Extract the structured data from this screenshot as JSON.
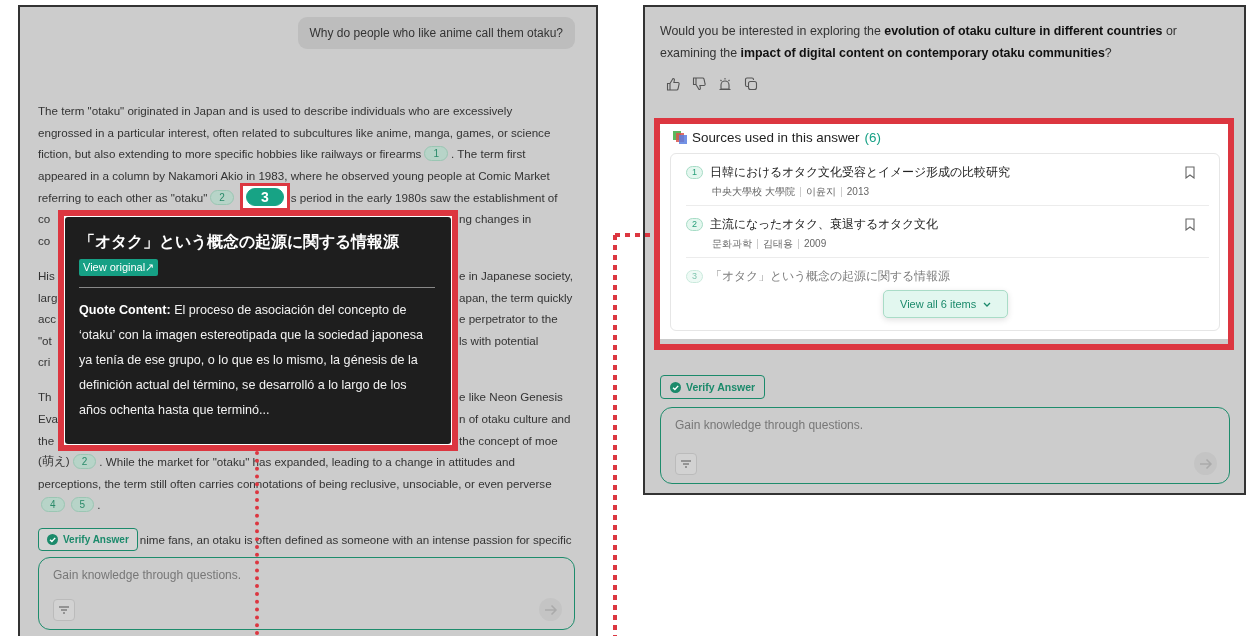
{
  "left_panel": {
    "user_message": "Why do people who like anime call them otaku?",
    "paragraphs": [
      {
        "lines": [
          {
            "left": [
              {
                "kind": "text",
                "text": "The term \"otaku\" originated in Japan and is used to describe individuals who are excessively"
              }
            ]
          },
          {
            "left": [
              {
                "kind": "text",
                "text": "engrossed in a particular interest, often related to subcultures like anime, manga, games, or science"
              }
            ]
          },
          {
            "left": [
              {
                "kind": "text",
                "text": "fiction, but also extending to more specific hobbies like railways or firearms"
              },
              {
                "kind": "cite",
                "number": "1",
                "selected": false
              },
              {
                "kind": "text",
                "text": ". The term first"
              }
            ]
          },
          {
            "left": [
              {
                "kind": "text",
                "text": "appeared in a column by Nakamori Akio in 1983, where he observed young people at Comic Market"
              }
            ]
          },
          {
            "left": [
              {
                "kind": "text",
                "text": "referring to each other as \"otaku\""
              },
              {
                "kind": "cite",
                "number": "2",
                "selected": false
              },
              {
                "kind": "cite",
                "number": "3",
                "selected": true
              },
              {
                "kind": "text",
                "text": "s period in the early 1980s saw the establishment of"
              }
            ]
          },
          {
            "left": [
              {
                "kind": "text",
                "text": "co"
              }
            ],
            "right": [
              {
                "kind": "text",
                "text": "ng changes in"
              }
            ]
          },
          {
            "left": [
              {
                "kind": "text",
                "text": "co"
              }
            ]
          }
        ]
      },
      {
        "lines": [
          {
            "left": [
              {
                "kind": "text",
                "text": "His"
              }
            ],
            "right": [
              {
                "kind": "text",
                "text": "e in Japanese society,"
              }
            ]
          },
          {
            "left": [
              {
                "kind": "text",
                "text": "larg"
              }
            ],
            "right": [
              {
                "kind": "text",
                "text": "apan, the term quickly"
              }
            ]
          },
          {
            "left": [
              {
                "kind": "text",
                "text": "acc"
              }
            ],
            "right": [
              {
                "kind": "text",
                "text": "e perpetrator to the"
              }
            ]
          },
          {
            "left": [
              {
                "kind": "text",
                "text": "\"ot"
              }
            ],
            "right": [
              {
                "kind": "text",
                "text": "ls with potential"
              }
            ]
          },
          {
            "left": [
              {
                "kind": "text",
                "text": "cri"
              }
            ]
          }
        ]
      },
      {
        "lines": [
          {
            "left": [
              {
                "kind": "text",
                "text": "Th"
              }
            ],
            "right": [
              {
                "kind": "text",
                "text": "e like Neon Genesis"
              }
            ]
          },
          {
            "left": [
              {
                "kind": "text",
                "text": "Eva"
              }
            ],
            "right": [
              {
                "kind": "text",
                "text": "n of otaku culture and"
              }
            ]
          },
          {
            "left": [
              {
                "kind": "text",
                "text": "the"
              }
            ],
            "right": [
              {
                "kind": "text",
                "text": "the concept of moe"
              }
            ]
          },
          {
            "left": [
              {
                "kind": "text",
                "text": "(萌え)"
              },
              {
                "kind": "cite",
                "number": "2",
                "selected": false
              },
              {
                "kind": "text",
                "text": ". While the market for \"otaku\" has expanded, leading to a change in attitudes and"
              }
            ]
          },
          {
            "left": [
              {
                "kind": "text",
                "text": "perceptions, the term still often carries connotations of being reclusive, unsociable, or even perverse"
              }
            ]
          },
          {
            "left": [
              {
                "kind": "cite",
                "number": "4",
                "selected": false
              },
              {
                "kind": "cite",
                "number": "5",
                "selected": false
              },
              {
                "kind": "text",
                "text": "."
              }
            ]
          }
        ]
      },
      {
        "lines": [
          {
            "left": [
              {
                "kind": "text",
                "text": "nime fans, an otaku is often defined as someone with an intense passion for specific"
              }
            ]
          }
        ]
      }
    ],
    "verify_button": "Verify Answer",
    "input": {
      "placeholder": "Gain knowledge through questions."
    }
  },
  "tooltip": {
    "title": "「オタク」という概念の起源に関する情報源",
    "link": "View original↗",
    "quote": "**Quote Content:** El proceso de asociación del concepto de ‘otaku’ con la imagen estereotipada que la sociedad japonesa ya tenía de ese grupo, o lo que es lo mismo, la génesis de la definición actual del término, se desarrolló a lo largo de los años ochenta hasta que terminó..."
  },
  "right_panel": {
    "question": "Would you be interested in exploring the **evolution of otaku culture in different countries** or examining the **impact of digital content on contemporary otaku communities**?",
    "sources": {
      "title": "Sources used in this answer",
      "count": "(6)",
      "items": [
        {
          "number": "1",
          "title": "日韓におけるオタク文化受容とイメージ形成の比較研究",
          "meta": [
            "中央大學校 大學院",
            "이윤지",
            "2013"
          ],
          "faded": false
        },
        {
          "number": "2",
          "title": "主流になったオタク、衰退するオタク文化",
          "meta": [
            "문화과학",
            "김태용",
            "2009"
          ],
          "faded": false
        },
        {
          "number": "3",
          "title": "「オタク」という概念の起源に関する情報源",
          "faded": true
        }
      ],
      "view_all": "View all 6 items"
    },
    "verify_button": "Verify Answer",
    "input": {
      "placeholder": "Gain knowledge through questions."
    }
  }
}
